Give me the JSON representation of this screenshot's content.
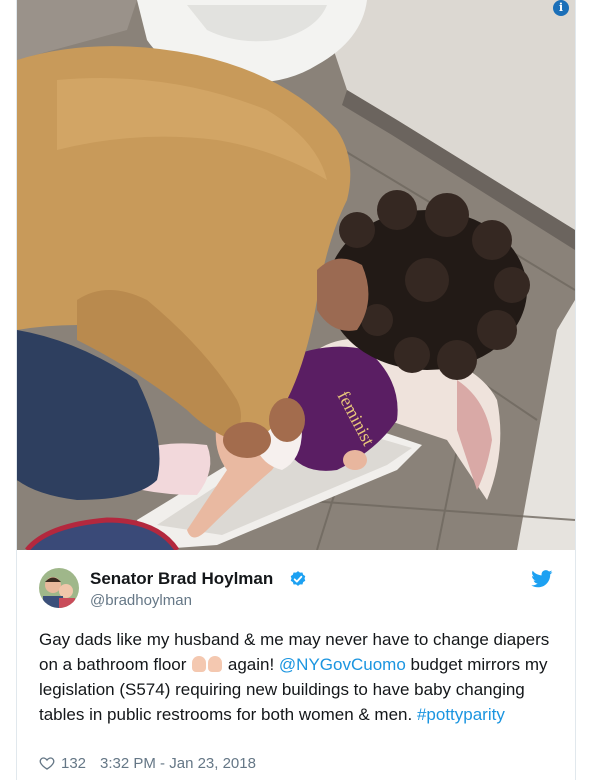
{
  "tweet": {
    "author_name": "Senator Brad Hoylman",
    "handle": "@bradhoylman",
    "text_part1": "Gay dads like my husband & me may never have to change diapers on a bathroom floor ",
    "emoji_name": "backhand-index-pointing-down",
    "text_part2": " again! ",
    "mention": "@NYGovCuomo",
    "text_part3": " budget mirrors my legislation (S574) requiring new buildings to have baby changing tables in public restrooms for both women & men. ",
    "hashtag": "#pottyparity",
    "likes": "132",
    "timestamp": "3:32 PM - Jan 23, 2018"
  },
  "photo": {
    "onesie_text": "feminist",
    "description_icon": "info-icon"
  },
  "colors": {
    "link": "#1b95e0",
    "verified": "#1da1f2",
    "twitter_bird": "#1da1f2",
    "onesie": "#5a1e63",
    "jacket": "#c89a5a"
  }
}
